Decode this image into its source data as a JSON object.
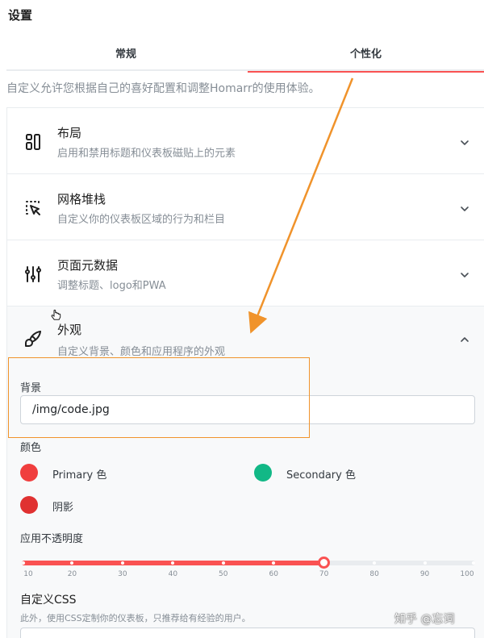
{
  "window": {
    "title": "设置"
  },
  "tabs": [
    {
      "label": "常规",
      "active": false
    },
    {
      "label": "个性化",
      "active": true
    }
  ],
  "description": "自定义允许您根据自己的喜好配置和调整Homarr的使用体验。",
  "sections": [
    {
      "title": "布局",
      "subtitle": "启用和禁用标题和仪表板磁贴上的元素",
      "icon": "layout-icon",
      "expanded": false
    },
    {
      "title": "网格堆栈",
      "subtitle": "自定义你的仪表板区域的行为和栏目",
      "icon": "grid-select-icon",
      "expanded": false
    },
    {
      "title": "页面元数据",
      "subtitle": "调整标题、logo和PWA",
      "icon": "adjustments-icon",
      "expanded": false
    },
    {
      "title": "外观",
      "subtitle": "自定义背景、颜色和应用程序的外观",
      "icon": "brush-icon",
      "expanded": true
    }
  ],
  "appearance": {
    "background_label": "背景",
    "background_value": "/img/code.jpg",
    "colors_label": "颜色",
    "colors": [
      {
        "label": "Primary 色",
        "color": "#f03e3e"
      },
      {
        "label": "Secondary 色",
        "color": "#12b886"
      },
      {
        "label": "阴影",
        "color": "#e03131"
      }
    ],
    "opacity_label": "应用不透明度",
    "opacity_value": 70,
    "opacity_marks": [
      "10",
      "20",
      "30",
      "40",
      "50",
      "60",
      "70",
      "80",
      "90",
      "100"
    ],
    "custom_css_label": "自定义CSS",
    "custom_css_help": "此外，使用CSS定制你的仪表板，只推荐给有经验的用户。"
  },
  "accent_color": "#fa5252",
  "annotation_color": "#f0932b",
  "watermark": "知乎 @忘词"
}
